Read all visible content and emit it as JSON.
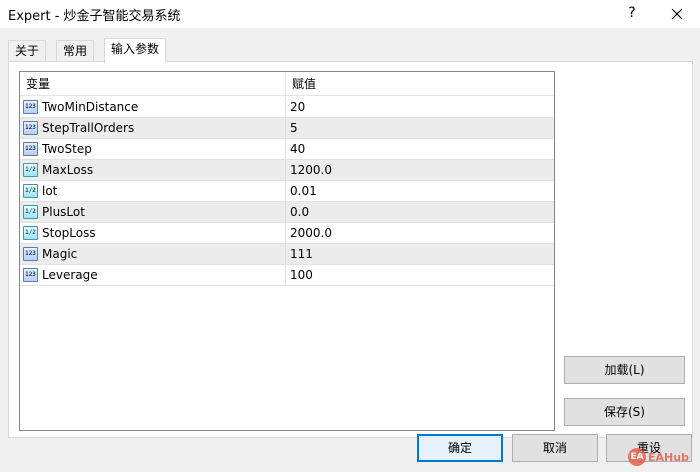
{
  "window": {
    "title": "Expert - 炒金子智能交易系统",
    "help_glyph": "?",
    "close_icon": "close-icon"
  },
  "tabs": [
    {
      "label": "关于",
      "active": false
    },
    {
      "label": "常用",
      "active": false
    },
    {
      "label": "输入参数",
      "active": true
    }
  ],
  "grid": {
    "columns": [
      "变量",
      "赋值"
    ],
    "rows": [
      {
        "name": "TwoMinDistance",
        "value": "20",
        "type_icon": "123"
      },
      {
        "name": "StepTrallOrders",
        "value": "5",
        "type_icon": "123"
      },
      {
        "name": "TwoStep",
        "value": "40",
        "type_icon": "123"
      },
      {
        "name": "MaxLoss",
        "value": "1200.0",
        "type_icon": "1/2"
      },
      {
        "name": "lot",
        "value": "0.01",
        "type_icon": "1/2"
      },
      {
        "name": "PlusLot",
        "value": "0.0",
        "type_icon": "1/2"
      },
      {
        "name": "StopLoss",
        "value": "2000.0",
        "type_icon": "1/2"
      },
      {
        "name": "Magic",
        "value": "111",
        "type_icon": "123"
      },
      {
        "name": "Leverage",
        "value": "100",
        "type_icon": "123"
      }
    ]
  },
  "buttons": {
    "load": "加载(L)",
    "save": "保存(S)",
    "ok": "确定",
    "cancel": "取消",
    "reset": "重设"
  },
  "watermark": {
    "badge": "EA",
    "text": "EAHub"
  },
  "colors": {
    "primary_border": "#0078d7",
    "int_icon": "#5a79b8",
    "float_icon": "#3c99ac"
  }
}
